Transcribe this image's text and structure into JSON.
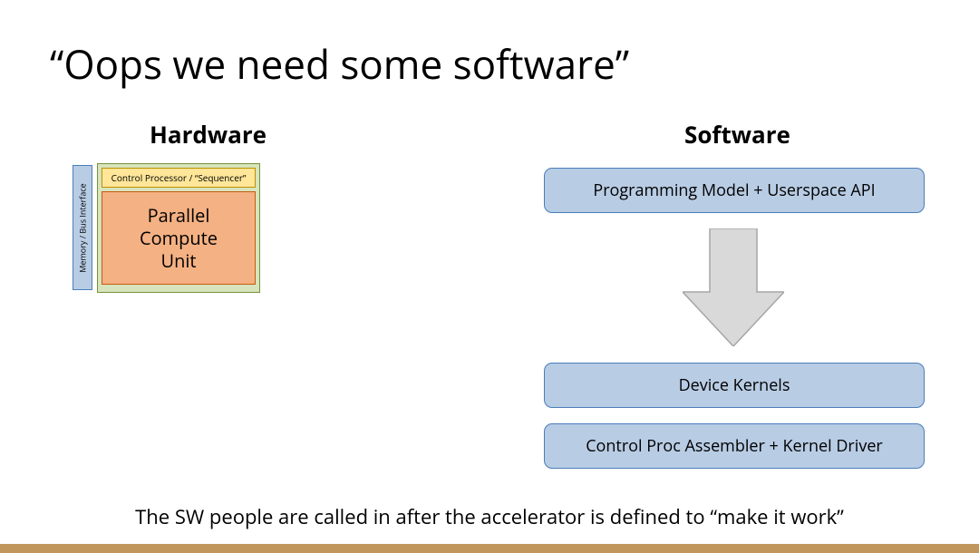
{
  "title": "“Oops we need some software”",
  "columns": {
    "hardware_heading": "Hardware",
    "software_heading": "Software"
  },
  "hardware": {
    "mem_bus": "Memory / Bus Interface",
    "sequencer": "Control Processor / “Sequencer”",
    "pcu_line1": "Parallel",
    "pcu_line2": "Compute",
    "pcu_line3": "Unit"
  },
  "software": {
    "box1": "Programming Model + Userspace API",
    "box2": "Device Kernels",
    "box3": "Control Proc Assembler + Kernel Driver"
  },
  "footer": "The SW people are called in after the accelerator is defined to “make it work”",
  "colors": {
    "blue_fill": "#b8cce4",
    "blue_border": "#4a7ebb",
    "green_fill": "#d7e4bd",
    "green_border": "#77933c",
    "yellow_fill": "#ffe699",
    "yellow_border": "#bf9000",
    "orange_fill": "#f4b183",
    "orange_border": "#c55a11",
    "arrow_fill": "#d9d9d9",
    "arrow_border": "#a6a6a6",
    "footer_bar": "#c0965c"
  }
}
